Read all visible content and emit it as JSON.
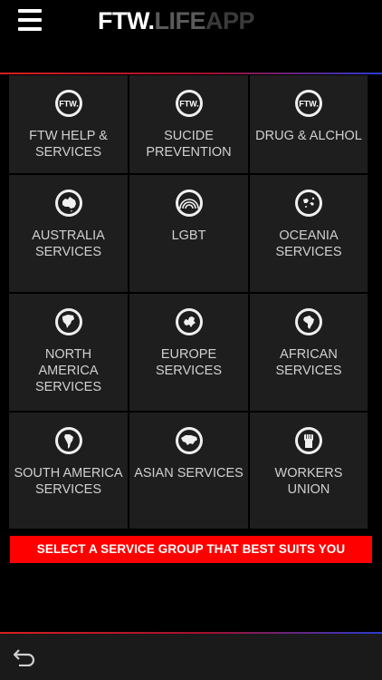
{
  "header": {
    "logo_brand": "FTW.",
    "logo_life": "LIFE",
    "logo_app": "APP"
  },
  "grid": {
    "items": [
      {
        "label": "FTW HELP &\nSERVICES",
        "icon": "ftw-logo-icon"
      },
      {
        "label": "SUCIDE\nPREVENTION",
        "icon": "ftw-logo-icon"
      },
      {
        "label": "DRUG & ALCHOL",
        "icon": "ftw-logo-icon"
      },
      {
        "label": "AUSTRALIA\nSERVICES",
        "icon": "australia-icon"
      },
      {
        "label": "LGBT",
        "icon": "rainbow-icon"
      },
      {
        "label": "OCEANIA\nSERVICES",
        "icon": "oceania-icon"
      },
      {
        "label": "NORTH\nAMERICA\nSERVICES",
        "icon": "north-america-icon"
      },
      {
        "label": "EUROPE\nSERVICES",
        "icon": "europe-icon"
      },
      {
        "label": "AFRICAN\nSERVICES",
        "icon": "africa-icon"
      },
      {
        "label": "SOUTH AMERICA\nSERVICES",
        "icon": "south-america-icon"
      },
      {
        "label": "ASIAN SERVICES",
        "icon": "asia-icon"
      },
      {
        "label": "WORKERS\nUNION",
        "icon": "raised-fist-icon"
      }
    ]
  },
  "banner": {
    "text": "SELECT A SERVICE GROUP THAT BEST SUITS YOU"
  },
  "colors": {
    "banner_bg": "#ff0000",
    "tile_bg": "#1e1e1e",
    "accent_red": "#d72020",
    "accent_blue": "#2a3bd0"
  }
}
